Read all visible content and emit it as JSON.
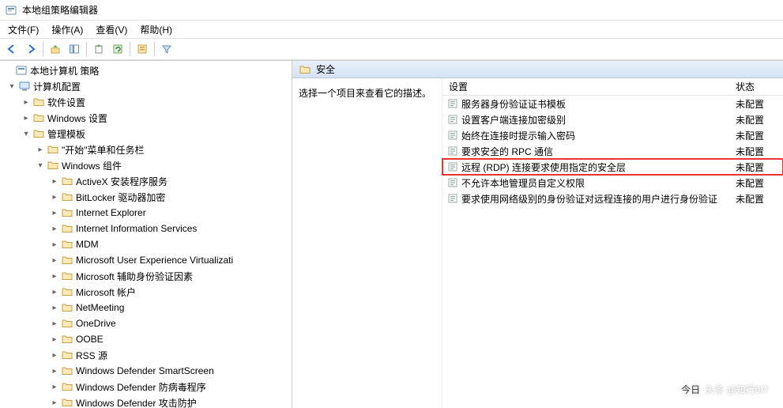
{
  "title": "本地组策略编辑器",
  "menu": {
    "file": "文件(F)",
    "action": "操作(A)",
    "view": "查看(V)",
    "help": "帮助(H)"
  },
  "tree": {
    "root": "本地计算机 策略",
    "computer_cfg": "计算机配置",
    "software": "软件设置",
    "windows_settings": "Windows 设置",
    "admin_templates": "管理模板",
    "start_menu": "\"开始\"菜单和任务栏",
    "win_components": "Windows 组件",
    "items": [
      "ActiveX 安装程序服务",
      "BitLocker 驱动器加密",
      "Internet Explorer",
      "Internet Information Services",
      "MDM",
      "Microsoft User Experience Virtualizati",
      "Microsoft 辅助身份验证因素",
      "Microsoft 帐户",
      "NetMeeting",
      "OneDrive",
      "OOBE",
      "RSS 源",
      "Windows Defender SmartScreen",
      "Windows Defender 防病毒程序",
      "Windows Defender 攻击防护"
    ]
  },
  "right": {
    "header": "安全",
    "desc_prompt": "选择一个项目来查看它的描述。",
    "col_setting": "设置",
    "col_state": "状态",
    "state_unconfigured": "未配置",
    "settings": [
      "服务器身份验证证书模板",
      "设置客户端连接加密级别",
      "始终在连接时提示输入密码",
      "要求安全的 RPC 通信",
      "远程 (RDP) 连接要求使用指定的安全层",
      "不允许本地管理员自定义权限",
      "要求使用网络级别的身份验证对远程连接的用户进行身份验证"
    ],
    "highlight_index": 4
  },
  "watermark": "头条 @知行0IT"
}
